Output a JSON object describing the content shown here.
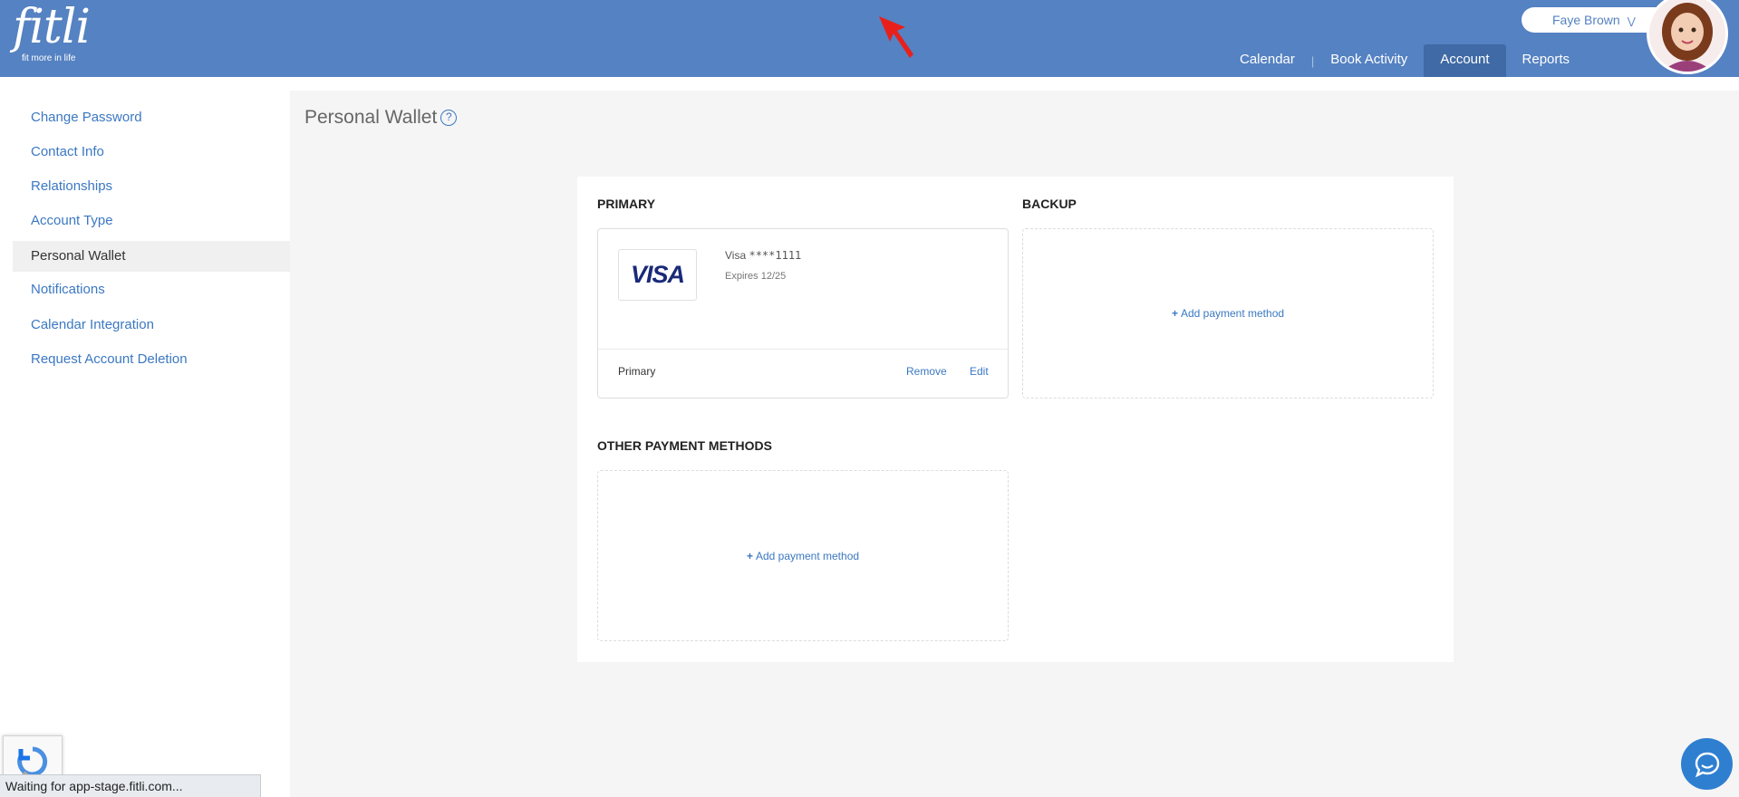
{
  "app": {
    "logo_word": "fitli",
    "logo_tagline": "fit more in life"
  },
  "header": {
    "user_name": "Faye Brown",
    "nav": [
      {
        "label": "Calendar"
      },
      {
        "label": "Book Activity"
      },
      {
        "label": "Account"
      },
      {
        "label": "Reports"
      }
    ],
    "active_nav": "Account"
  },
  "sidebar": {
    "items": [
      {
        "label": "Change Password"
      },
      {
        "label": "Contact Info"
      },
      {
        "label": "Relationships"
      },
      {
        "label": "Account Type"
      },
      {
        "label": "Personal Wallet"
      },
      {
        "label": "Notifications"
      },
      {
        "label": "Calendar Integration"
      },
      {
        "label": "Request Account Deletion"
      }
    ],
    "active_item": "Personal Wallet"
  },
  "main": {
    "title": "Personal Wallet",
    "help_glyph": "?",
    "sections": {
      "primary": {
        "label": "PRIMARY",
        "card": {
          "brand": "VISA",
          "mask_prefix": "Visa ",
          "mask_digits": "****1111",
          "expires": "Expires 12/25",
          "status": "Primary",
          "remove_label": "Remove",
          "edit_label": "Edit"
        }
      },
      "backup": {
        "label": "BACKUP",
        "add_label": "Add payment method"
      },
      "other": {
        "label": "OTHER PAYMENT METHODS",
        "add_label": "Add payment method"
      }
    }
  },
  "browser": {
    "status_text": "Waiting for app-stage.fitli.com..."
  },
  "colors": {
    "header_bg": "#5582c2",
    "active_nav_bg": "#3f6aa5",
    "link": "#3b78c2",
    "content_bg": "#f5f5f5"
  },
  "icons": [
    "help-icon",
    "chevron-down-icon",
    "plus-icon",
    "recaptcha-icon",
    "chat-icon",
    "cursor-arrow-icon"
  ]
}
